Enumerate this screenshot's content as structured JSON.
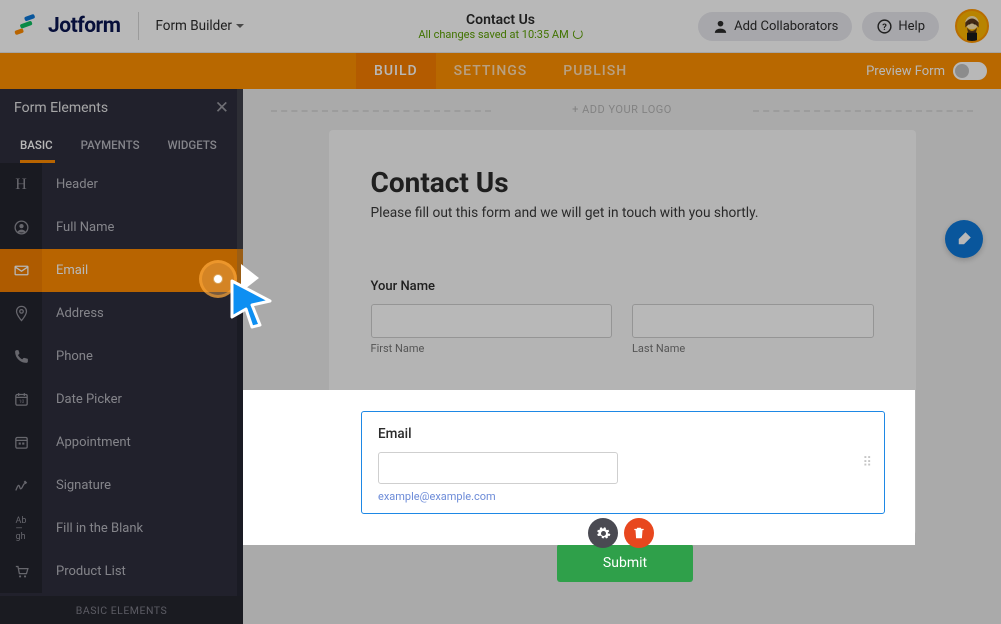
{
  "topbar": {
    "brand": "Jotform",
    "builder_label": "Form Builder",
    "form_title": "Contact Us",
    "save_status": "All changes saved at 10:35 AM",
    "add_collaborators": "Add Collaborators",
    "help": "Help"
  },
  "nav": {
    "tabs": [
      "BUILD",
      "SETTINGS",
      "PUBLISH"
    ],
    "preview_label": "Preview Form"
  },
  "panel": {
    "title": "Form Elements",
    "tabs": [
      "BASIC",
      "PAYMENTS",
      "WIDGETS"
    ],
    "items": [
      {
        "label": "Header",
        "icon": "H"
      },
      {
        "label": "Full Name",
        "icon": "user"
      },
      {
        "label": "Email",
        "icon": "mail"
      },
      {
        "label": "Address",
        "icon": "pin"
      },
      {
        "label": "Phone",
        "icon": "phone"
      },
      {
        "label": "Date Picker",
        "icon": "date"
      },
      {
        "label": "Appointment",
        "icon": "appt"
      },
      {
        "label": "Signature",
        "icon": "sig"
      },
      {
        "label": "Fill in the Blank",
        "icon": "blank"
      },
      {
        "label": "Product List",
        "icon": "cart"
      }
    ],
    "footer": "BASIC ELEMENTS"
  },
  "canvas": {
    "add_logo": "+ ADD YOUR LOGO",
    "heading": "Contact Us",
    "subheading": "Please fill out this form and we will get in touch with you shortly.",
    "your_name_label": "Your Name",
    "first_name": "First Name",
    "last_name": "Last Name",
    "email_label": "Email",
    "email_hint": "example@example.com",
    "submit": "Submit"
  },
  "colors": {
    "orange": "#ff8b00",
    "blue": "#1e88e5",
    "green": "#2fa04a"
  }
}
